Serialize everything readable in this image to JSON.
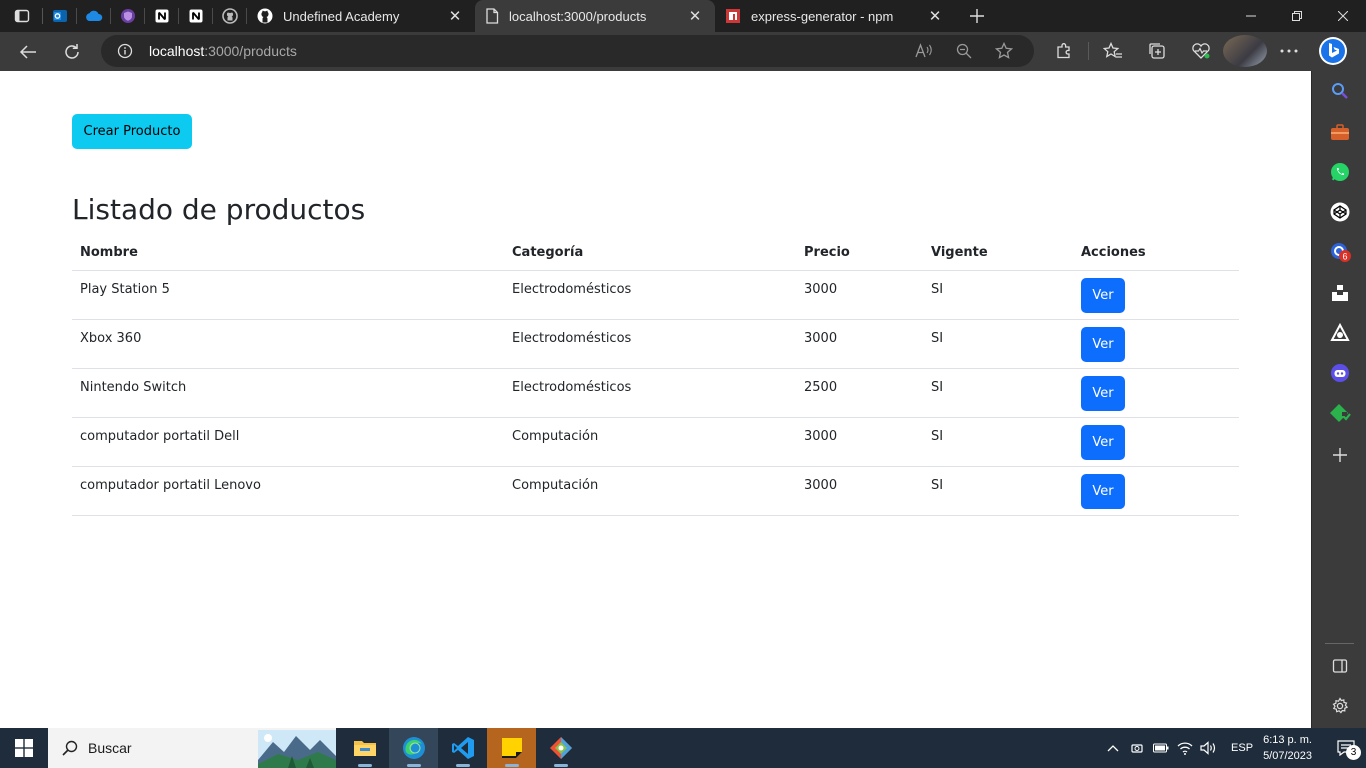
{
  "browser": {
    "tabs": [
      {
        "title": "Undefined Academy",
        "icon": "github-icon",
        "active": false
      },
      {
        "title": "localhost:3000/products",
        "icon": "page-icon",
        "active": true
      },
      {
        "title": "express-generator - npm",
        "icon": "npm-icon",
        "active": false
      }
    ],
    "pinned_tabs": [
      "outlook-icon",
      "onedrive-icon",
      "shield-extension-icon",
      "notion-icon",
      "notion-icon",
      "github-icon"
    ],
    "address": {
      "host": "localhost",
      "path": ":3000/products"
    }
  },
  "page": {
    "create_button": "Crear Producto",
    "title": "Listado de productos",
    "table": {
      "headers": [
        "Nombre",
        "Categoría",
        "Precio",
        "Vigente",
        "Acciones"
      ],
      "rows": [
        {
          "nombre": "Play Station 5",
          "categoria": "Electrodomésticos",
          "precio": "3000",
          "vigente": "SI",
          "action": "Ver"
        },
        {
          "nombre": "Xbox 360",
          "categoria": "Electrodomésticos",
          "precio": "3000",
          "vigente": "SI",
          "action": "Ver"
        },
        {
          "nombre": "Nintendo Switch",
          "categoria": "Electrodomésticos",
          "precio": "2500",
          "vigente": "SI",
          "action": "Ver"
        },
        {
          "nombre": "computador portatil Dell",
          "categoria": "Computación",
          "precio": "3000",
          "vigente": "SI",
          "action": "Ver"
        },
        {
          "nombre": "computador portatil Lenovo",
          "categoria": "Computación",
          "precio": "3000",
          "vigente": "SI",
          "action": "Ver"
        }
      ]
    }
  },
  "sidebar": {
    "badges": {
      "outlook": "6"
    }
  },
  "taskbar": {
    "search_placeholder": "Buscar",
    "language": "ESP",
    "time": "6:13 p. m.",
    "date": "5/07/2023",
    "notifications": "3"
  },
  "colors": {
    "create_button": "#0dcaf0",
    "view_button": "#0d6efd",
    "browser_dark": "#202020",
    "toolbar": "#3b3b3b",
    "taskbar": "#1f2c3b"
  }
}
